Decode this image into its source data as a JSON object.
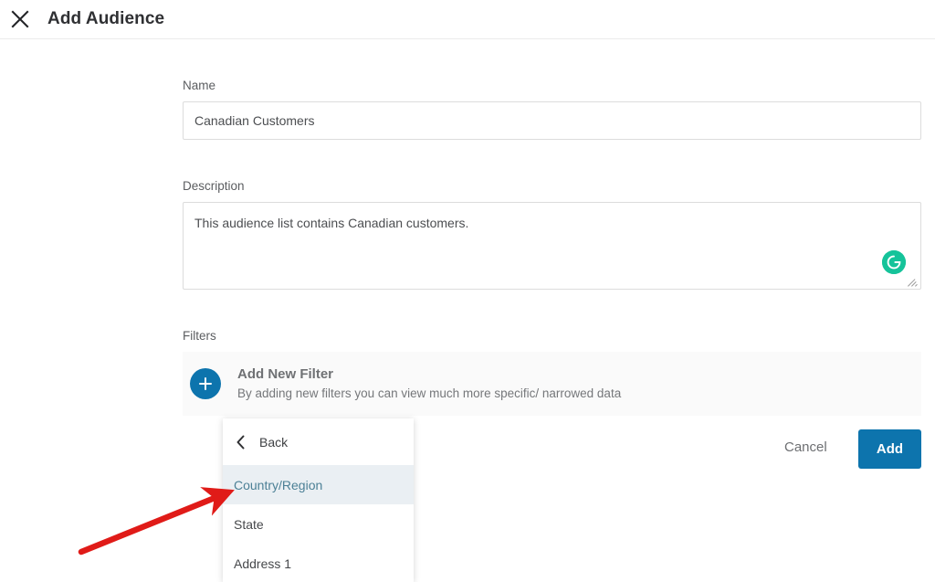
{
  "header": {
    "title": "Add Audience",
    "close_icon": "close-icon"
  },
  "form": {
    "name": {
      "label": "Name",
      "value": "Canadian Customers",
      "placeholder": "Name"
    },
    "description": {
      "label": "Description",
      "value": "This audience list contains Canadian customers.",
      "placeholder": "Description",
      "assistant_icon": "grammarly-icon",
      "assistant_letter": "G"
    },
    "filters": {
      "label": "Filters",
      "add_icon": "plus-icon",
      "title": "Add New Filter",
      "subtitle": "By adding new filters you can view much more specific/ narrowed data"
    }
  },
  "dropdown": {
    "back_icon": "chevron-left-icon",
    "back_label": "Back",
    "items": [
      {
        "label": "Country/Region",
        "active": true
      },
      {
        "label": "State",
        "active": false
      },
      {
        "label": "Address 1",
        "active": false
      }
    ]
  },
  "actions": {
    "cancel_label": "Cancel",
    "add_label": "Add"
  },
  "annotation": {
    "arrow": "red-arrow-annotation"
  },
  "colors": {
    "primary_blue": "#0d74ad",
    "highlight_bg": "#eaeff3",
    "highlight_text": "#4c8096",
    "grammarly_green": "#15c39a",
    "annotation_red": "#e01b18",
    "card_bg": "#fafafa"
  }
}
